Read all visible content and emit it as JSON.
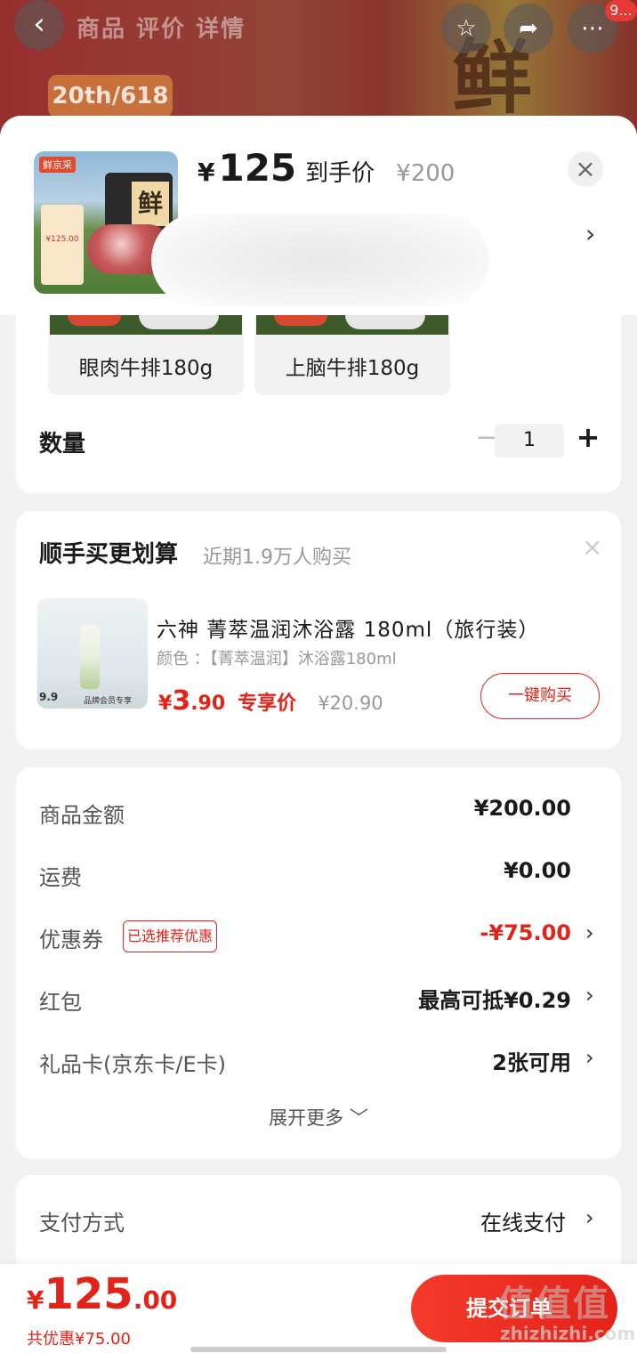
{
  "background": {
    "tabs": "商品 评价 详情",
    "promo": "20th/618",
    "brand_glyph": "鲜",
    "badge": "9..."
  },
  "header": {
    "thumb_brand": "鲜京采",
    "thumb_price": "¥125.00",
    "thumb_glyph": "鲜",
    "currency": "¥",
    "price": "125",
    "price_label": "到手价",
    "original_price": "¥200",
    "close": "×",
    "chevron": "›"
  },
  "variants": [
    {
      "label": "眼肉牛排180g"
    },
    {
      "label": "上脑牛排180g"
    }
  ],
  "quantity": {
    "label": "数量",
    "minus": "−",
    "value": "1",
    "plus": "+"
  },
  "upsell": {
    "title": "顺手买更划算",
    "subtitle": "近期1.9万人购买",
    "close": "×",
    "product_name": "六神  菁萃温润沐浴露  180ml（旅行装）",
    "product_spec": "颜色 ：【菁萃温润】沐浴露180ml",
    "img_tag_price": "9.9",
    "img_tag_vip": "品牌会员专享",
    "currency": "¥",
    "price_int": "3",
    "price_dec": ".90",
    "price_tag": "专享价",
    "original_price": "¥20.90",
    "buy_label": "一键购买"
  },
  "price_detail": {
    "rows": [
      {
        "label": "商品金额",
        "value": "¥200.00"
      },
      {
        "label": "运费",
        "value": "¥0.00"
      },
      {
        "label": "优惠券",
        "value": "-¥75.00",
        "tag": "已选推荐优惠"
      },
      {
        "label": "红包",
        "value": "最高可抵¥0.29"
      },
      {
        "label": "礼品卡(京东卡/E卡)",
        "value": "2张可用"
      }
    ],
    "expand": "展开更多 ﹀",
    "arrow": "›"
  },
  "payment": {
    "label": "支付方式",
    "value": "在线支付",
    "arrow": "›"
  },
  "bottom": {
    "currency": "¥",
    "total_int": "125",
    "total_dec": ".00",
    "saving": "共优惠¥75.00",
    "submit": "提交订单"
  },
  "watermark": {
    "main": "值值值",
    "sub": "zhizhizhi.com"
  },
  "colors": {
    "accent": "#e2231a",
    "muted": "#999999",
    "page_bg": "#f2f2f2"
  }
}
